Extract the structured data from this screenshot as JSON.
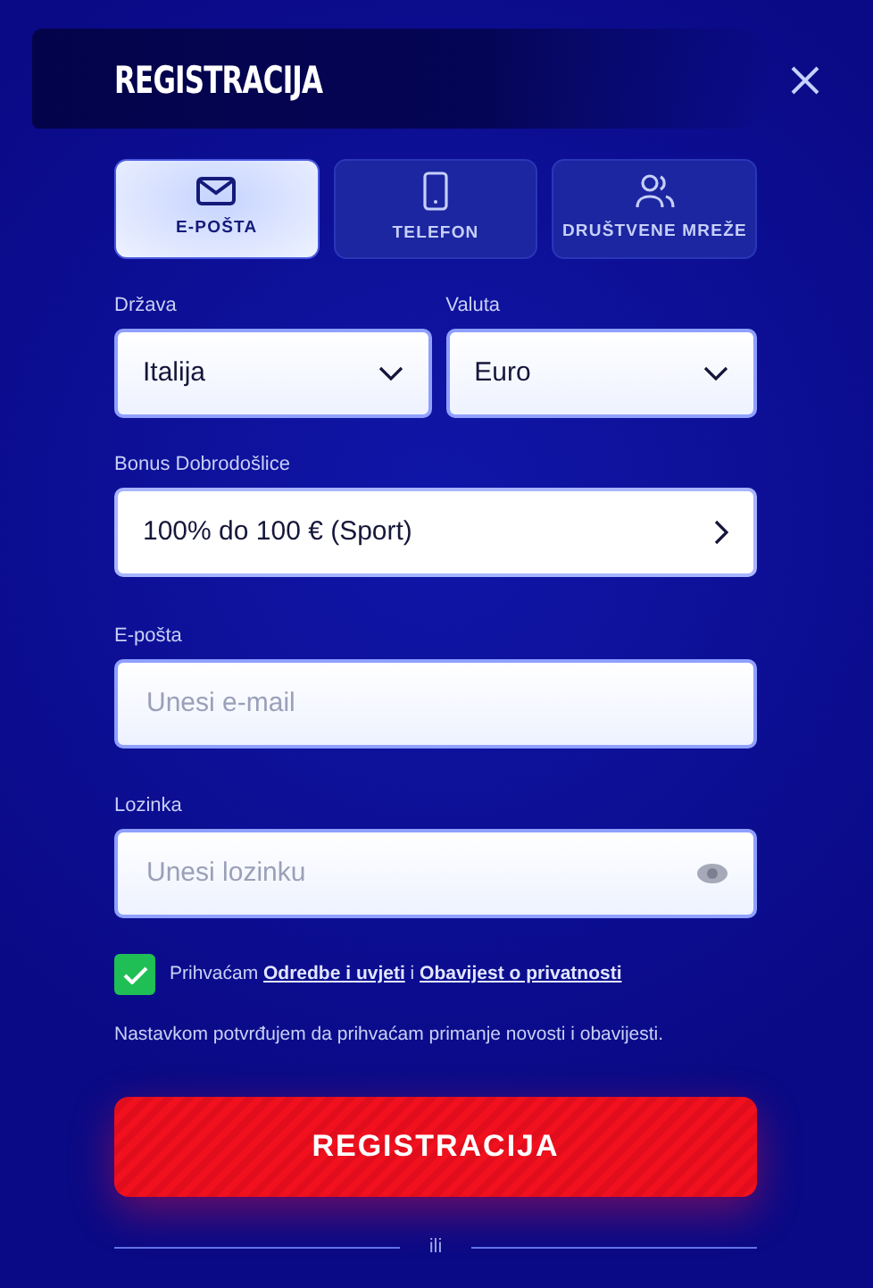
{
  "title": "REGISTRACIJA",
  "tabs": [
    {
      "label": "E-POŠTA",
      "kind": "email",
      "selected": true
    },
    {
      "label": "TELEFON",
      "kind": "phone",
      "selected": false
    },
    {
      "label": "DRUŠTVENE MREŽE",
      "kind": "social",
      "selected": false
    }
  ],
  "selects": [
    {
      "label": "Država",
      "value": "Italija"
    },
    {
      "label": "Valuta",
      "value": "Euro"
    }
  ],
  "bonus": {
    "label": "Bonus Dobrodošlice",
    "value": "100% do 100 € (Sport)"
  },
  "email": {
    "label": "E-pošta",
    "placeholder": "Unesi e-mail"
  },
  "password": {
    "label": "Lozinka",
    "placeholder": "Unesi lozinku"
  },
  "consent": {
    "checked": true,
    "prefix": "Prihvaćam",
    "links": [
      "Odredbe i uvjeti",
      "Obavijest o privatnosti"
    ],
    "joiner": "i"
  },
  "notice": "Nastavkom potvrđujem da prihvaćam primanje novosti i obavijesti.",
  "submit": "REGISTRACIJA",
  "divider": "ili"
}
